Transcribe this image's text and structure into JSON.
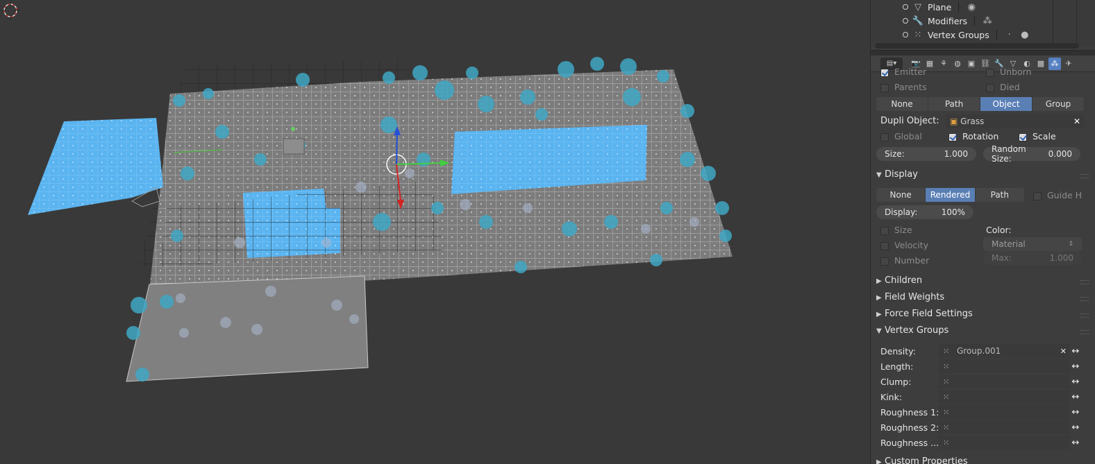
{
  "outliner": {
    "items": [
      {
        "label": "Plane",
        "icon": "plane-data-icon",
        "extra_icon": "material-sphere-icon"
      },
      {
        "label": "Modifiers",
        "icon": "wrench-icon",
        "extra_icon": "particles-icon"
      },
      {
        "label": "Vertex Groups",
        "icon": "vertex-groups-icon",
        "extra_icon": "dot-icon"
      }
    ]
  },
  "properties": {
    "clipped_top": {
      "emitter": "Emitter",
      "unborn": "Unborn"
    },
    "render_flags": {
      "parents": "Parents",
      "died": "Died"
    },
    "render_as": {
      "options": [
        "None",
        "Path",
        "Object",
        "Group"
      ],
      "selected": "Object"
    },
    "dupli_object": {
      "label": "Dupli Object:",
      "value": "Grass"
    },
    "dupli_flags": {
      "global": "Global",
      "rotation": "Rotation",
      "scale": "Scale"
    },
    "size": {
      "label": "Size:",
      "value": "1.000"
    },
    "random_size": {
      "label": "Random Size:",
      "value": "0.000"
    },
    "display_panel": {
      "title": "Display",
      "modes": [
        "None",
        "Rendered",
        "Path"
      ],
      "selected": "Rendered",
      "guide_hairs": "Guide H",
      "display_percent": {
        "label": "Display:",
        "value": "100%"
      },
      "show_size": "Size",
      "show_velocity": "Velocity",
      "show_number": "Number",
      "color_label": "Color:",
      "color_value": "Material",
      "max": {
        "label": "Max:",
        "value": "1.000"
      }
    },
    "collapsed_panels": [
      "Children",
      "Field Weights",
      "Force Field Settings"
    ],
    "vertex_groups_panel": {
      "title": "Vertex Groups",
      "rows": [
        {
          "label": "Density:",
          "value": "Group.001"
        },
        {
          "label": "Length:",
          "value": ""
        },
        {
          "label": "Clump:",
          "value": ""
        },
        {
          "label": "Kink:",
          "value": ""
        },
        {
          "label": "Roughness 1:",
          "value": ""
        },
        {
          "label": "Roughness 2:",
          "value": ""
        },
        {
          "label": "Roughness ...",
          "value": ""
        }
      ]
    },
    "clipped_bottom": "Custom Properties"
  },
  "colors": {
    "viewport_bg": "#393939",
    "mesh_face": "#7a7a7a",
    "selected_face": "#5ab4f0",
    "grass": "#3fa7c4",
    "accent": "#5a7fb5"
  }
}
